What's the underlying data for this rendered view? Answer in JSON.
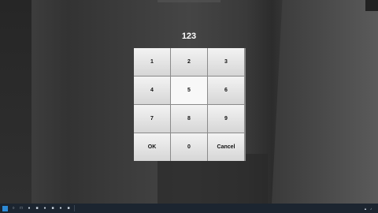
{
  "keypad": {
    "display": "123",
    "keys": [
      {
        "label": "1"
      },
      {
        "label": "2"
      },
      {
        "label": "3"
      },
      {
        "label": "4"
      },
      {
        "label": "5"
      },
      {
        "label": "6"
      },
      {
        "label": "7"
      },
      {
        "label": "8"
      },
      {
        "label": "9"
      },
      {
        "label": "OK"
      },
      {
        "label": "0"
      },
      {
        "label": "Cancel"
      }
    ]
  },
  "colors": {
    "title_text": "#ffffff",
    "key_face": "#e6e6e6",
    "taskbar": "#1c2530"
  },
  "taskbar": {
    "icons": [
      "windows-icon",
      "search-icon",
      "task-view-icon",
      "app-icon",
      "app-icon",
      "app-icon",
      "app-icon",
      "app-icon",
      "app-icon"
    ],
    "clock_time": "",
    "clock_date": ""
  }
}
